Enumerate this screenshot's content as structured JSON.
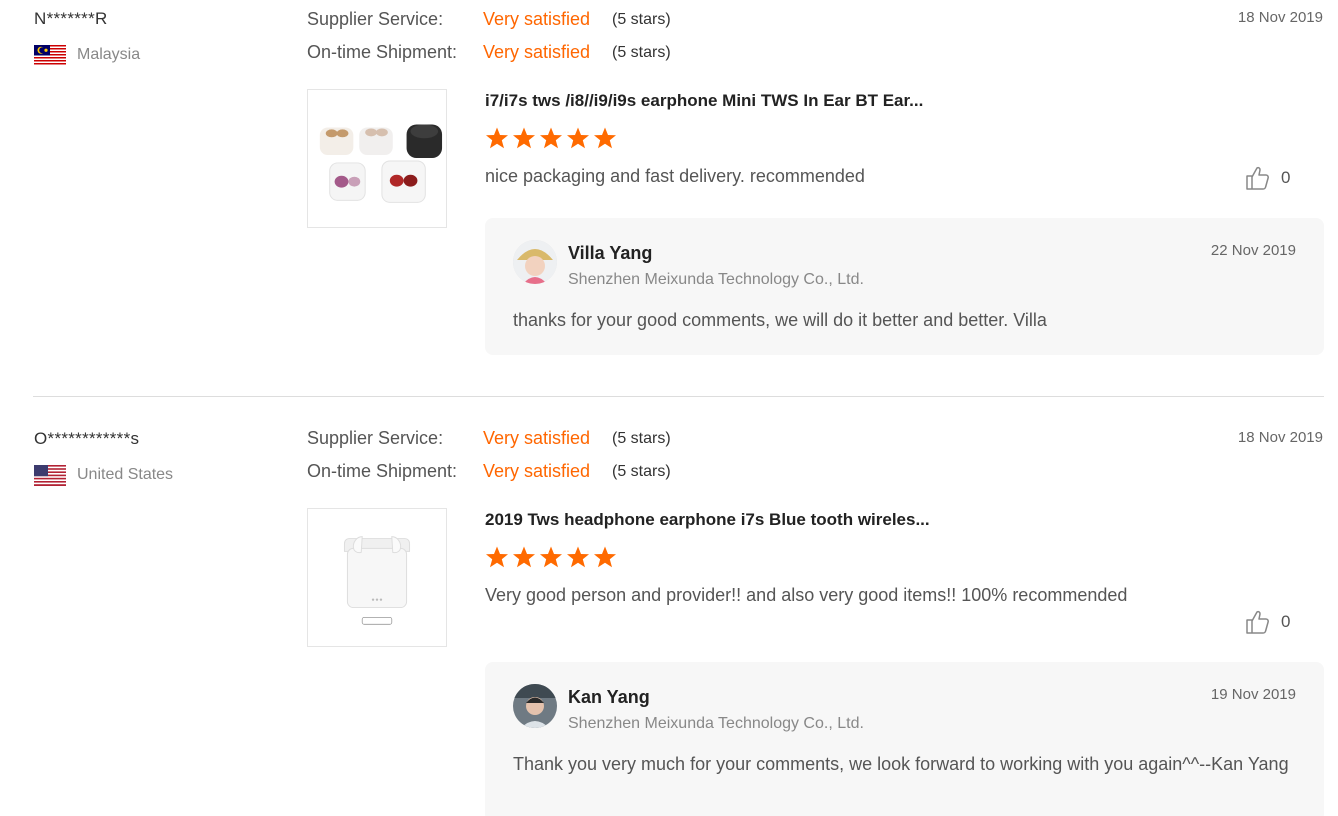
{
  "reviews": [
    {
      "buyer_name": "N*******R",
      "country": "Malaysia",
      "flag_icon": "malaysia-flag-icon",
      "supplier_service_label": "Supplier Service:",
      "supplier_service_value": "Very satisfied",
      "supplier_service_stars": "(5 stars)",
      "shipment_label": "On-time Shipment:",
      "shipment_value": "Very satisfied",
      "shipment_stars": "(5 stars)",
      "date": "18 Nov 2019",
      "product_title": "i7/i7s tws /i8//i9/i9s earphone Mini TWS In Ear BT Ear...",
      "product_rating": 5,
      "comment": "nice packaging and fast delivery. recommended",
      "likes": "0",
      "reply": {
        "name": "Villa Yang",
        "company": "Shenzhen Meixunda Technology Co., Ltd.",
        "date": "22 Nov 2019",
        "text": "thanks for your good comments, we will do it better and better. Villa"
      }
    },
    {
      "buyer_name": "O************s",
      "country": "United States",
      "flag_icon": "usa-flag-icon",
      "supplier_service_label": "Supplier Service:",
      "supplier_service_value": "Very satisfied",
      "supplier_service_stars": "(5 stars)",
      "shipment_label": "On-time Shipment:",
      "shipment_value": "Very satisfied",
      "shipment_stars": "(5 stars)",
      "date": "18 Nov 2019",
      "product_title": "2019 Tws headphone earphone i7s Blue tooth wireles...",
      "product_rating": 5,
      "comment": "Very good person and provider!! and also very good items!! 100% recommended",
      "likes": "0",
      "reply": {
        "name": "Kan Yang",
        "company": "Shenzhen Meixunda Technology Co., Ltd.",
        "date": "19 Nov 2019",
        "text": "Thank you very much for your comments, we look forward to working with you again^^--Kan Yang"
      }
    }
  ],
  "colors": {
    "accent": "#ff6600",
    "star": "#ff6a00",
    "reply_bg": "#f7f7f7"
  }
}
